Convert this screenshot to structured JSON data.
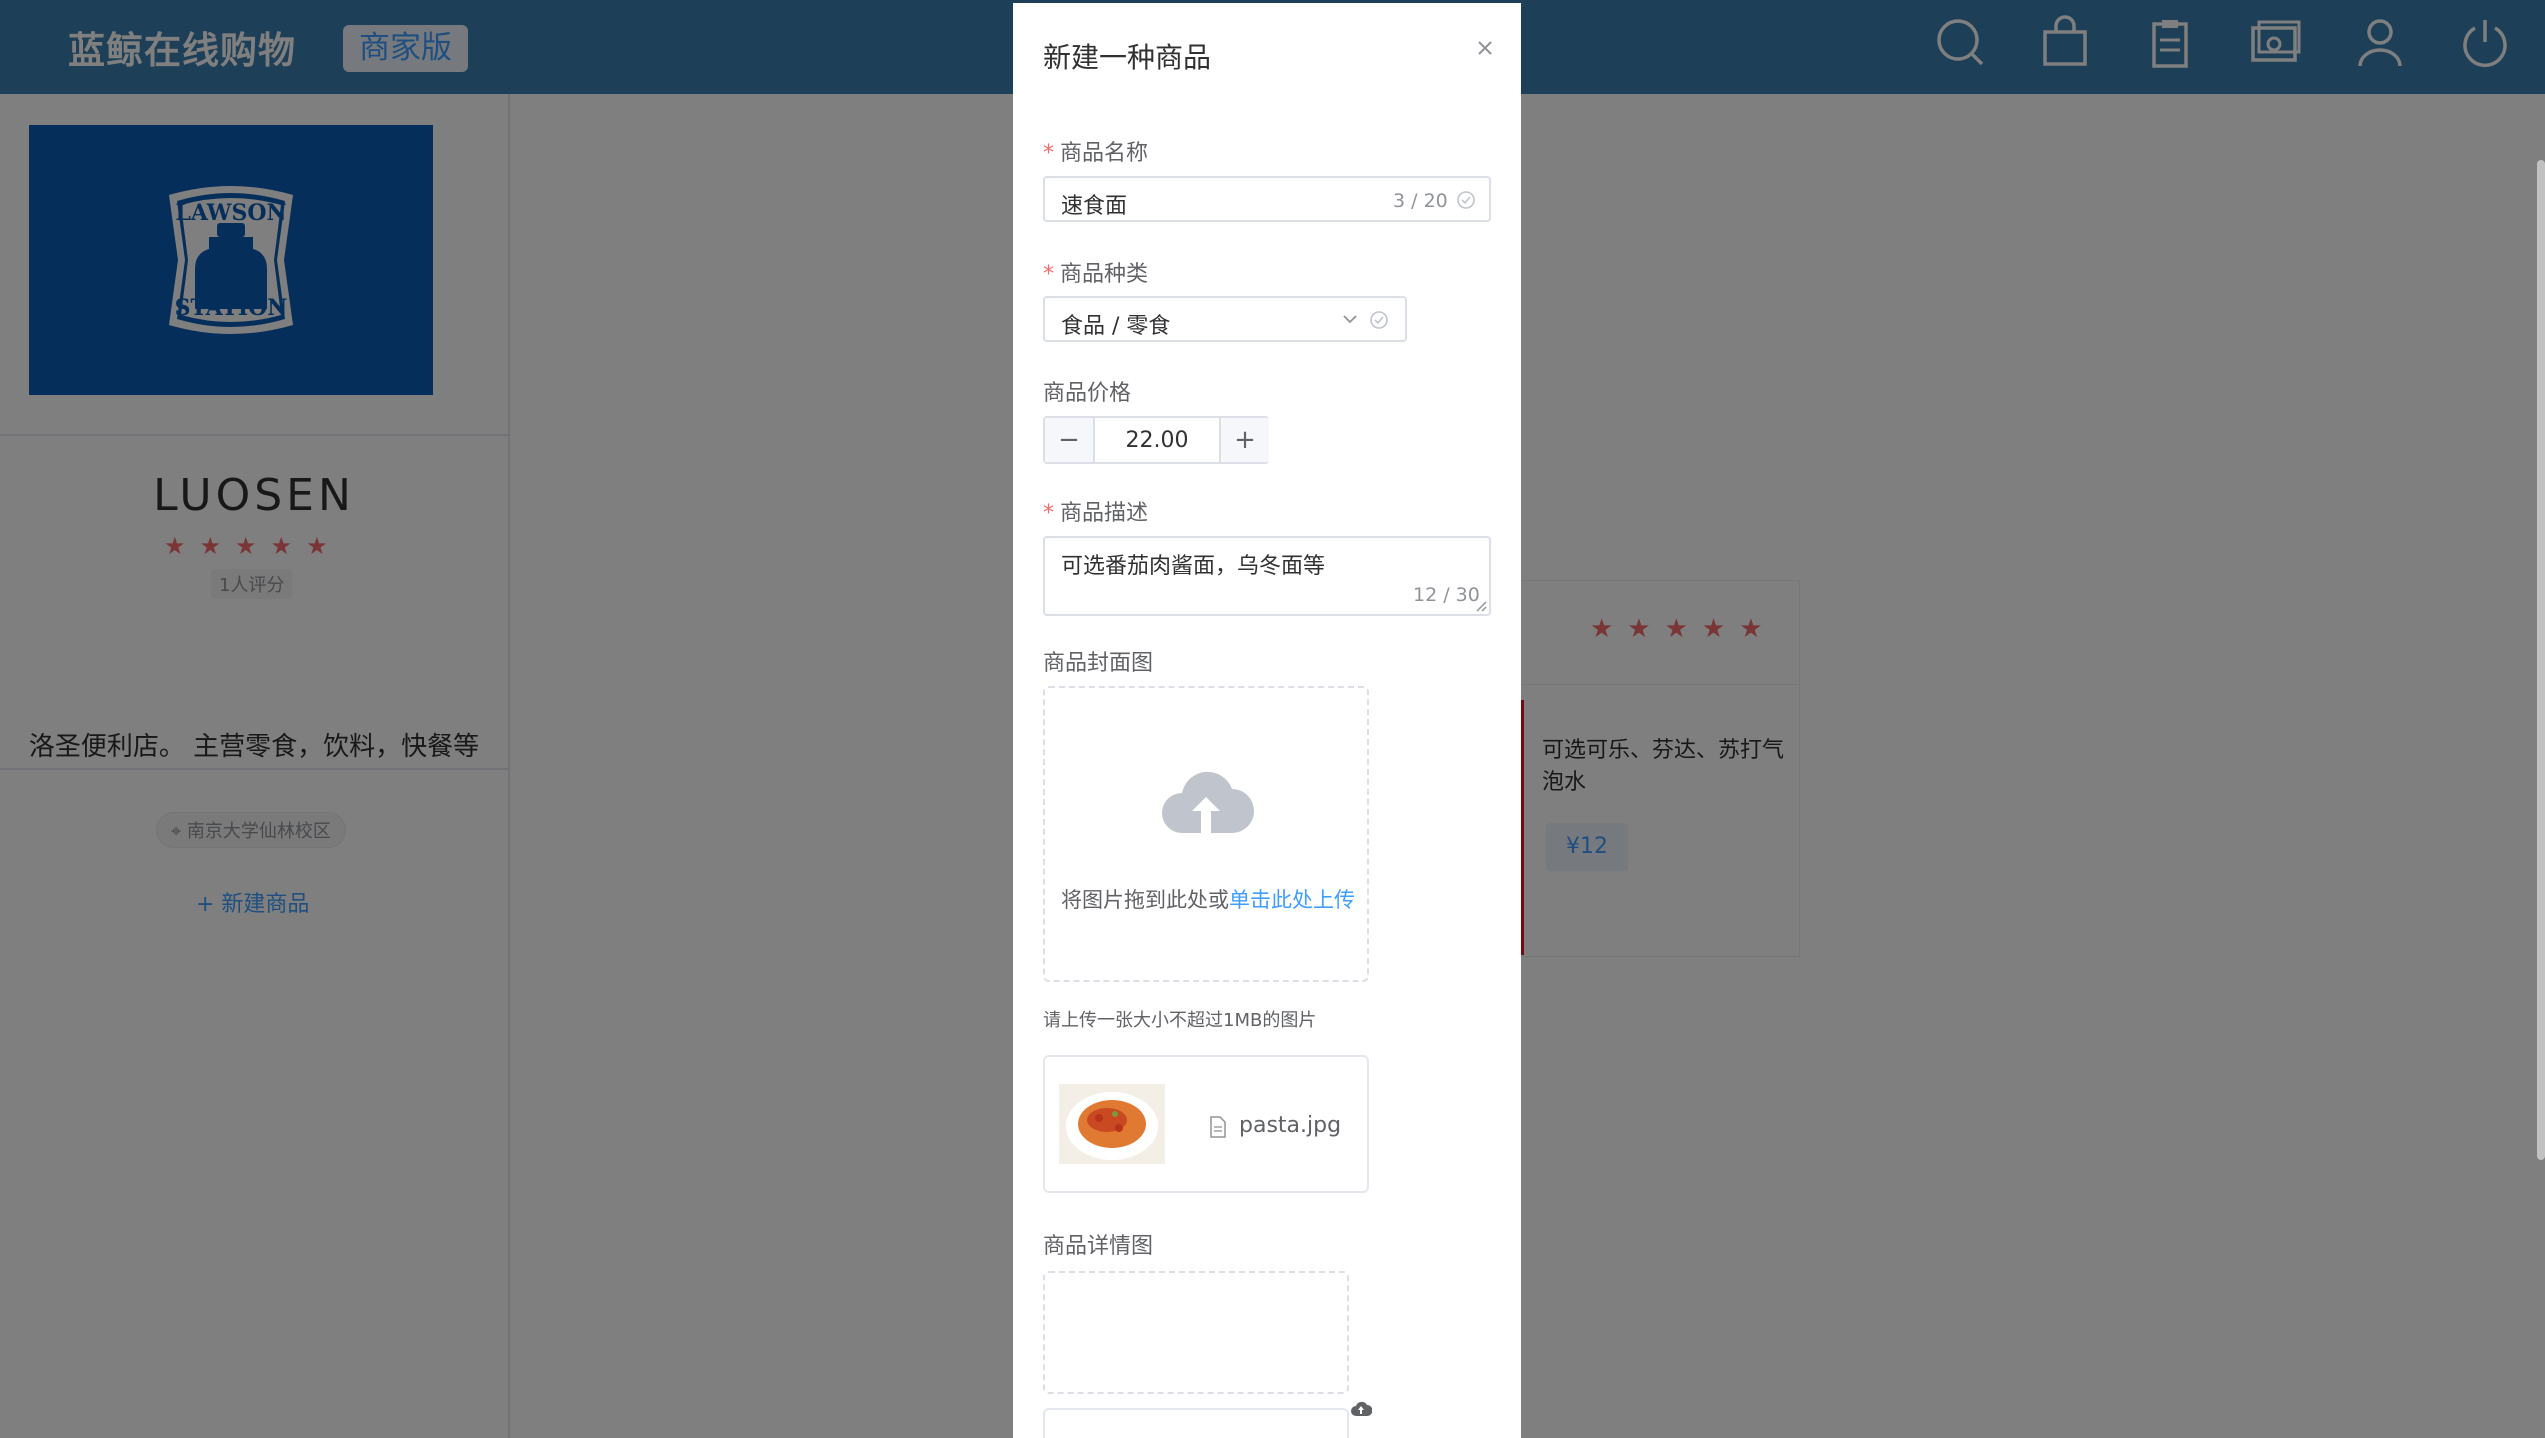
{
  "header": {
    "brand": "蓝鲸在线购物",
    "badge": "商家版",
    "icons": [
      "search-icon",
      "shopping-bag-icon",
      "clipboard-icon",
      "wallet-icon",
      "user-icon",
      "power-icon"
    ]
  },
  "store": {
    "logo_text_top": "LAWSON",
    "logo_text_bottom": "STATION",
    "name": "LUOSEN",
    "rating_stars": "★★★★★",
    "rating_count": "1人评分",
    "description": "洛圣便利店。 主营零食，饮料，快餐等",
    "location": "南京大学仙林校区",
    "new_product_link": "+ 新建商品"
  },
  "product_card": {
    "stars": "★★★★★",
    "description": "可选可乐、芬达、苏打气泡水",
    "price": "¥12"
  },
  "dialog": {
    "title": "新建一种商品",
    "required_mark": "*",
    "name": {
      "label": "商品名称",
      "value": "速食面",
      "count": "3 / 20"
    },
    "category": {
      "label": "商品种类",
      "value": "食品 / 零食"
    },
    "price": {
      "label": "商品价格",
      "value": "22.00",
      "minus": "−",
      "plus": "+"
    },
    "description": {
      "label": "商品描述",
      "value": "可选番茄肉酱面，乌冬面等",
      "count": "12 / 30"
    },
    "cover": {
      "label": "商品封面图",
      "drag_text": "将图片拖到此处或",
      "click_text": "单击此处上传",
      "tip": "请上传一张大小不超过1MB的图片",
      "file_name": "pasta.jpg"
    },
    "detail": {
      "label": "商品详情图"
    }
  },
  "colors": {
    "topbar": "#3b7fae",
    "accent": "#409eff",
    "star": "#f56c6c",
    "required": "#f56c6c",
    "logo_bg": "#0a5fb4"
  }
}
